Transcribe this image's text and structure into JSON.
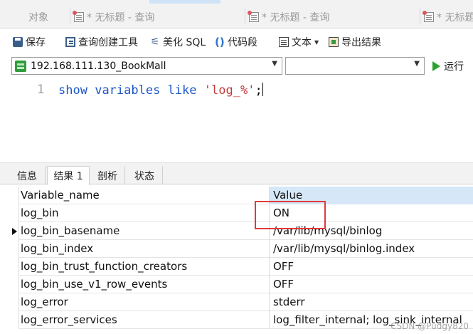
{
  "tabs": [
    {
      "label": "对象",
      "icon": "none"
    },
    {
      "label": "* 无标题 - 查询",
      "icon": "query-icon"
    },
    {
      "label": "* 无标题 - 查询",
      "icon": "query-icon"
    },
    {
      "label": "* 无标题",
      "icon": "query-icon"
    }
  ],
  "toolbar": {
    "save": "保存",
    "query_builder": "查询创建工具",
    "beautify_sql": "美化 SQL",
    "code_snippet": "代码段",
    "text": "文本",
    "export_results": "导出结果"
  },
  "connection": {
    "selected": "192.168.111.130_BookMall",
    "database": "",
    "run": "运行"
  },
  "editor": {
    "line_number": "1",
    "kw1": "show",
    "kw2": "variables",
    "kw3": "like",
    "str": "'log_%'",
    "end": ";"
  },
  "result_tabs": [
    "信息",
    "结果 1",
    "剖析",
    "状态"
  ],
  "grid": {
    "headers": [
      "Variable_name",
      "Value"
    ],
    "rows": [
      [
        "log_bin",
        "ON"
      ],
      [
        "log_bin_basename",
        "/var/lib/mysql/binlog"
      ],
      [
        "log_bin_index",
        "/var/lib/mysql/binlog.index"
      ],
      [
        "log_bin_trust_function_creators",
        "OFF"
      ],
      [
        "log_bin_use_v1_row_events",
        "OFF"
      ],
      [
        "log_error",
        "stderr"
      ],
      [
        "log_error_services",
        "log_filter_internal; log_sink_internal"
      ]
    ]
  },
  "watermark": "CSDN @Pudgy820"
}
